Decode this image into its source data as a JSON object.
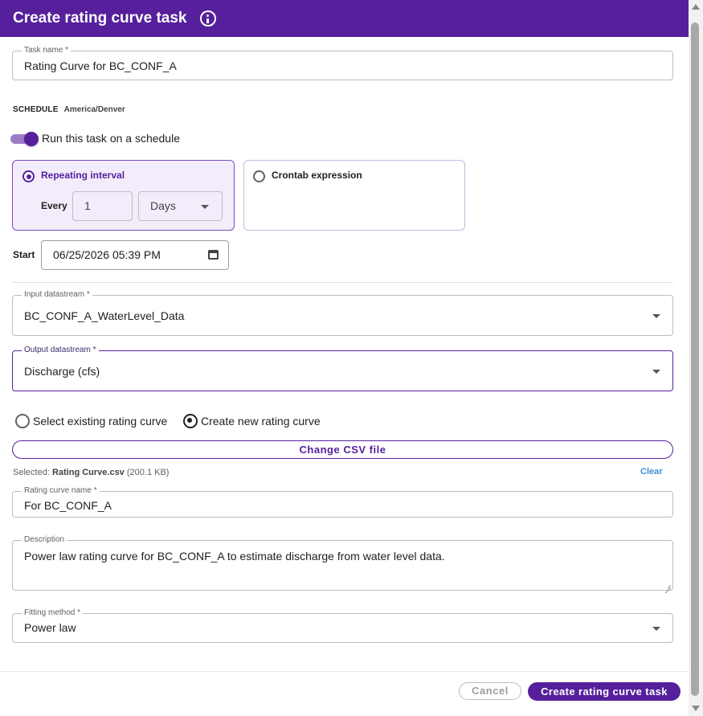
{
  "dialog": {
    "title": "Create rating curve task"
  },
  "task_name": {
    "label": "Task name *",
    "value": "Rating Curve for BC_CONF_A"
  },
  "schedule": {
    "section_label": "SCHEDULE",
    "timezone": "America/Denver",
    "toggle_label": "Run this task on a schedule",
    "toggle_on": true,
    "repeating": {
      "label": "Repeating interval",
      "selected": true,
      "every_label": "Every",
      "every_value": "1",
      "unit": "Days"
    },
    "crontab": {
      "label": "Crontab expression",
      "selected": false
    },
    "start_label": "Start",
    "start_value": "06/25/2026 05:39 PM"
  },
  "input_datastream": {
    "label": "Input datastream *",
    "value": "BC_CONF_A_WaterLevel_Data"
  },
  "output_datastream": {
    "label": "Output datastream *",
    "value": "Discharge (cfs)"
  },
  "rating_curve_mode": {
    "existing_label": "Select existing rating curve",
    "new_label": "Create new rating curve",
    "selected": "new"
  },
  "csv": {
    "change_button": "Change CSV file",
    "selected_prefix": "Selected:",
    "file_name": "Rating Curve.csv",
    "file_size": "(200.1 KB)",
    "clear_label": "Clear"
  },
  "rating_curve_name": {
    "label": "Rating curve name *",
    "value": "For BC_CONF_A"
  },
  "description": {
    "label": "Description",
    "value": "Power law rating curve for BC_CONF_A to estimate discharge from water level data."
  },
  "fitting_method": {
    "label": "Fitting method *",
    "value": "Power law"
  },
  "footer": {
    "cancel_label": "Cancel",
    "submit_label": "Create rating curve task"
  },
  "colors": {
    "accent": "#56209c",
    "link": "#3f8fd6"
  }
}
